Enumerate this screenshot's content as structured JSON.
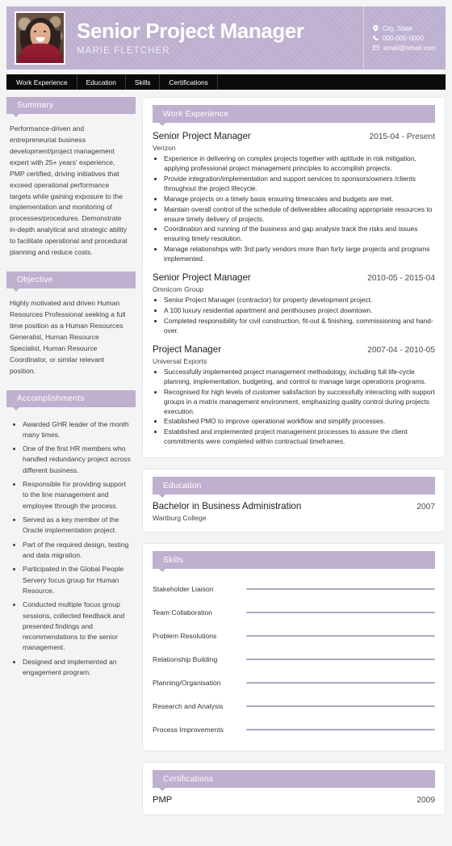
{
  "header": {
    "job_title": "Senior Project Manager",
    "person_name": "MARIE FLETCHER",
    "accent_color": "#bdafcf",
    "contact": {
      "location": "City, State",
      "phone": "000-000-0000",
      "email": "email@email.com"
    },
    "photo_alt": "portrait-photo"
  },
  "nav": {
    "items": [
      {
        "label": "Work Experience"
      },
      {
        "label": "Education"
      },
      {
        "label": "Skills"
      },
      {
        "label": "Certifications"
      }
    ]
  },
  "sidebar": {
    "summary": {
      "heading": "Summary",
      "text": "Performance-driven and entrepreneurial business development/project management expert with 25+ years' experience, PMP certified, driving initiatives that exceed operational performance targets while gaining exposure to the implementation and monitoring of processes/procedures. Demonstrate in-depth analytical and strategic ability to facilitate operational and procedural planning and reduce costs."
    },
    "objective": {
      "heading": "Objective",
      "text": "Highly motivated and driven Human Resources Professional seeking a full time position as a Human Resources Generalist, Human Resource Specialist, Human Resource Coordinator, or similar relevant position."
    },
    "accomplishments": {
      "heading": "Accomplishments",
      "items": [
        "Awarded GHR leader of the month many times.",
        "One of the first HR members who handled redundancy project across different business.",
        "Responsible for providing support to the line management and employee through the process.",
        "Served as a key member of the Oracle implementation project.",
        "Part of the required design, testing and data migration.",
        "Participated in the Global People Servery focus group for Human Resource.",
        "Conducted multiple focus group sessions, collected feedback and presented findings and recommendations to the senior management.",
        "Designed and implemented an engagement program."
      ]
    }
  },
  "work_experience": {
    "heading": "Work Experience",
    "entries": [
      {
        "role": "Senior Project Manager",
        "dates": "2015-04 - Present",
        "organization": "Verizon",
        "bullets": [
          "Experience in delivering on complex projects together with aptitude in risk mitigation, applying professional project management principles to accomplish projects.",
          "Provide integration/implementation and support services to sponsors/owners /clients throughout the project lifecycle.",
          "Manage projects on a timely basis ensuring timescales and budgets are met.",
          "Maintain overall control of the schedule of deliverables allocating appropriate resources to ensure timely delivery of projects.",
          "Coordination and running of the business and gap analysis track the risks and issues ensuring timely resolution.",
          "Manage relationships with 3rd party vendors more than forty large projects and programs implemented."
        ]
      },
      {
        "role": "Senior Project Manager",
        "dates": "2010-05 - 2015-04",
        "organization": "Omnicom Group",
        "bullets": [
          "Senior Project Manager (contractor) for property development project.",
          "A 100 luxury residential apartment and penthouses project downtown.",
          "Completed responsibility for civil construction, fit-out & finishing, commissioning and hand-over."
        ]
      },
      {
        "role": "Project Manager",
        "dates": "2007-04 - 2010-05",
        "organization": "Universal Exports",
        "bullets": [
          "Successfully implemented project management methodology, including full life-cycle planning, implementation, budgeting, and control to manage large operations programs.",
          "Recognised for high levels of customer satisfaction by successfully interacting with support groups in a matrix management environment, emphasizing quality control during projects execution.",
          "Established PMO to improve operational workflow and simplify processes.",
          "Established and implemented project management processes to assure the client commitments were completed within contractual timeframes."
        ]
      }
    ]
  },
  "education": {
    "heading": "Education",
    "entries": [
      {
        "degree": "Bachelor in Business Administration",
        "year": "2007",
        "school": "Wartburg College"
      }
    ]
  },
  "skills": {
    "heading": "Skills",
    "items": [
      {
        "name": "Stakeholder Liaison"
      },
      {
        "name": "Team Collaboration"
      },
      {
        "name": "Problem Resolutions"
      },
      {
        "name": "Relationship Building"
      },
      {
        "name": "Planning/Organisation"
      },
      {
        "name": "Research and Analysis"
      },
      {
        "name": "Process Improvements"
      }
    ]
  },
  "certifications": {
    "heading": "Certifications",
    "entries": [
      {
        "name": "PMP",
        "year": "2009"
      }
    ]
  }
}
